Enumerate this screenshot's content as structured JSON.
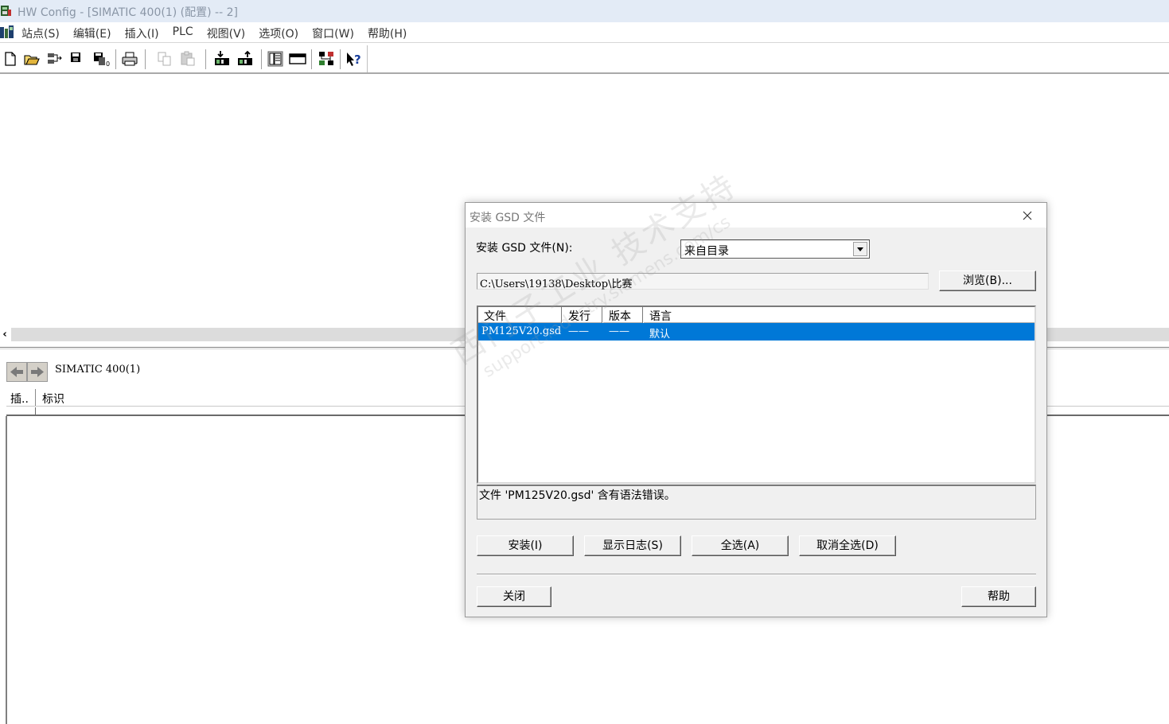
{
  "window": {
    "title": "HW Config - [SIMATIC 400(1) (配置) -- 2]"
  },
  "menu": {
    "items": [
      "站点(S)",
      "编辑(E)",
      "插入(I)",
      "PLC",
      "视图(V)",
      "选项(O)",
      "窗口(W)",
      "帮助(H)"
    ]
  },
  "toolbar": {
    "icons": [
      "new-icon",
      "open-icon",
      "accessible-nodes-icon",
      "save-icon",
      "save-compile-icon",
      "print-icon",
      "copy-icon",
      "paste-icon",
      "download-icon",
      "upload-icon",
      "catalog-icon",
      "network-view-icon",
      "configure-network-icon",
      "help-context-icon"
    ]
  },
  "station": {
    "label": "SIMATIC 400(1)"
  },
  "table": {
    "columns": [
      "插..",
      "标识"
    ]
  },
  "dialog": {
    "title": "安装 GSD 文件",
    "install_label": "安装 GSD 文件(N):",
    "source_select": "来自目录",
    "path": "C:\\Users\\19138\\Desktop\\比赛",
    "browse_button": "浏览(B)...",
    "list_columns": [
      "文件",
      "发行",
      "版本",
      "语言"
    ],
    "files": [
      {
        "file": "PM125V20.gsd",
        "release": "——",
        "version": "——",
        "language": "默认"
      }
    ],
    "message": "文件 'PM125V20.gsd' 含有语法错误。",
    "buttons": {
      "install": "安装(I)",
      "show_log": "显示日志(S)",
      "select_all": "全选(A)",
      "deselect_all": "取消全选(D)",
      "close": "关闭",
      "help": "帮助"
    }
  },
  "watermark": {
    "line1": "西门子工业 技术支持",
    "line2": "support.industry.siemens.com/cs"
  },
  "colors": {
    "selection": "#0078d7",
    "dialog_bg": "#f0f0f0",
    "titlebar_bg": "#e3ebf6"
  }
}
